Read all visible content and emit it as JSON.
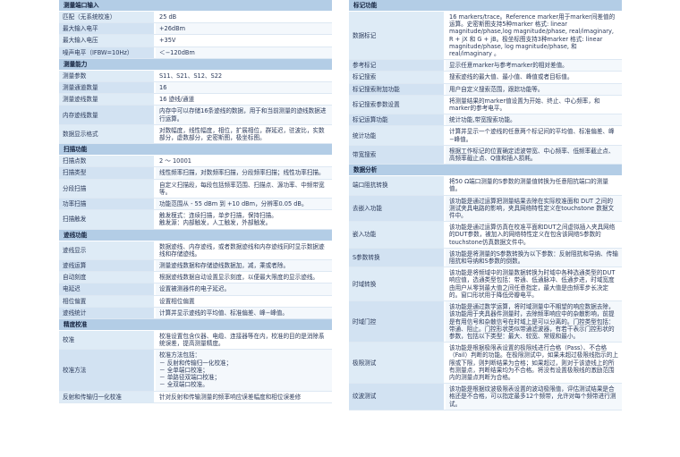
{
  "left": [
    {
      "type": "header",
      "text": "测量端口输入"
    },
    {
      "k": "匹配（无系统校准）",
      "v": "25 dB"
    },
    {
      "k": "最大输入电平",
      "v": "+26dBm"
    },
    {
      "k": "最大输入电压",
      "v": "+35V"
    },
    {
      "k": "噪声电平（IFBW=10Hz）",
      "v": "＜−120dBm"
    },
    {
      "type": "header",
      "text": "测量能力"
    },
    {
      "k": "测量参数",
      "v": "S11、S21、S12、S22"
    },
    {
      "k": "测量通道数量",
      "v": "16"
    },
    {
      "k": "测量迹线数量",
      "v": "16 迹线/通道"
    },
    {
      "k": "内存迹线数量",
      "v": "内存中可以存储16条迹线的数据，用于和当前测量的迹线数据进行运算。"
    },
    {
      "k": "数据显示格式",
      "v": "对数幅度，线性幅度，相位，扩展相位，群延迟，驻波比，实数部分，虚数部分，史密斯图，极坐标图。"
    },
    {
      "type": "header",
      "text": "扫描功能"
    },
    {
      "k": "扫描点数",
      "v": "2 ～ 10001"
    },
    {
      "k": "扫描类型",
      "v": "线性频率扫描，对数频率扫描，分段频率扫描；线性功率扫描。"
    },
    {
      "k": "分段扫描",
      "v": "自定义扫描段，每段包括频率范围、扫描点、源功率、中频带宽等。"
    },
    {
      "k": "功率扫描",
      "v": "功能范围从 - 55 dBm 到 +10 dBm，分辨率0.05 dB。"
    },
    {
      "k": "扫描触发",
      "v": "触发模式：连续扫描，单步扫描，保持扫描。\n触发源：内部触发，人工触发，外部触发。"
    },
    {
      "type": "header",
      "text": "迹线功能"
    },
    {
      "k": "迹线显示",
      "v": "数据迹线、内存迹线，或者数据迹线和内存迹线同时显示数据迹线和存储迹线。"
    },
    {
      "k": "迹线运算",
      "v": "测量迹线数据和存储迹线数据加，减，乘或者除。"
    },
    {
      "k": "自动刻度",
      "v": "根据迹线数据自动设置显示刻度，以便最大限度的显示迹线。"
    },
    {
      "k": "电延迟",
      "v": "设置被测器件的电子延迟。"
    },
    {
      "k": "相位偏置",
      "v": "设置相位偏置"
    },
    {
      "k": "迹线统计",
      "v": "计算并显示迹线的平均值、标准偏差、峰−峰值。"
    },
    {
      "type": "header",
      "text": "精度校准"
    },
    {
      "k": "校准",
      "v": "校准设置包含仪器、电缆、连接器等在内，校准的目的是消除系统误差，提高测量精度。"
    },
    {
      "k": "校准方法",
      "v": "校准方法包括：\n－ 反射和传输归一化校准；\n－ 全单端口校准；\n－ 单路径双端口校准；\n－ 全双端口校准。"
    },
    {
      "k": "反射和传输归一化校准",
      "v": "针对反射和传输测量的频率响应误差幅度和相位误差修"
    }
  ],
  "right": [
    {
      "type": "header",
      "text": "标记功能"
    },
    {
      "k": "数据标记",
      "v": "16 markers/trace。Reference marker用于marker间差值的运算。史密斯图支持5种marker 格式: linear magnitude/phase,log magnitude/phase, real/imaginary, R + jX 和 G + jB。极坐标图支持3种marker 格式: linear magnitude/phase, log magnitude/phase, 和real/imaginary 。"
    },
    {
      "k": "参考标记",
      "v": "显示任意marker与参考marker的相对差值。"
    },
    {
      "k": "标记搜索",
      "v": "搜索迹线的最大值、最小值、峰值或者目标值。"
    },
    {
      "k": "标记搜索附加功能",
      "v": "用户自定义搜索范围，跟踪功能等。"
    },
    {
      "k": "标记搜索参数设置",
      "v": "将测量结果的marker值设置为开始、终止、中心频率，和marker的参考电平。"
    },
    {
      "k": "标记运算功能",
      "v": "统计功能,带宽搜索功能。"
    },
    {
      "k": "统计功能",
      "v": "计算并显示一个迹线的任意两个标记间的平均值、标准偏差、峰−峰值。"
    },
    {
      "k": "带宽搜索",
      "v": "根据工作标记的位置确定滤波带宽、中心频率、低频率截止点、高频率截止点、Q值和插入损耗。"
    },
    {
      "type": "header",
      "text": "数据分析"
    },
    {
      "k": "端口阻抗转换",
      "v": "将50 Ω端口测量的S参数的测量值转换为任意阻抗端口的测量值。"
    },
    {
      "k": "去嵌入功能",
      "v": "该功能是通过运算把测量结果去除在实际校准面和 DUT 之间的测试夹具电路的影响，夹具网络特性定义在touchstone 数据文件中。"
    },
    {
      "k": "嵌入功能",
      "v": "该功能是通过运算仿真在校准平面和DUT之间虚拟插入夹具网络的DUT参数，被加入的网络特性定义在包含该网络S参数的touchstone仿真数据文件中。"
    },
    {
      "k": "S参数转换",
      "v": "该功能是将测量的S参数转换为以下参数：反射阻抗和导纳、传输阻抗和导纳和S参数的倒数。"
    },
    {
      "k": "时域转换",
      "v": "该功能是将频域中的测量数据转换为时域中各种选通类型的DUT响应值，选通类型包括：带通、低通脉冲、低通步进，时域宽度由用户从零到最大值之间任意指定，最大值是由频率步长决定的。窗口形状用于降低旁瓣电平。"
    },
    {
      "k": "时域门控",
      "v": "该功能是通过数学运算，将时域测量中不期望的响应数据去除，该功能用于夹具器件测量时，去除频率响应中的杂散影响，前提是有用信号和杂散信号在时域上是可以分离的。门控类型包括：带通、阻止。门控形状类似带通滤波器，有若干表示门控形状的参数，包括以下类型：最大、较宽、常规和最小。"
    },
    {
      "k": "极限测试",
      "v": "该功能是根据极限表设置的极限线进行合格（Pass）、不合格（Fail）判断的功能。在极限测试中，如果未超过极限线指示的上限或下限，则判断结果为合格；如果超过，则对于该迹线上的所有测量点，判断结果均为不合格。将没有设置极限线的激励范围内的测量点判断为合格。"
    },
    {
      "k": "纹波测试",
      "v": "该功能是根据纹波极限表设置的波动极限值，评估测试结果是合格还是不合格，可以指定最多12个频带，允许对每个频带进行测试。"
    }
  ]
}
